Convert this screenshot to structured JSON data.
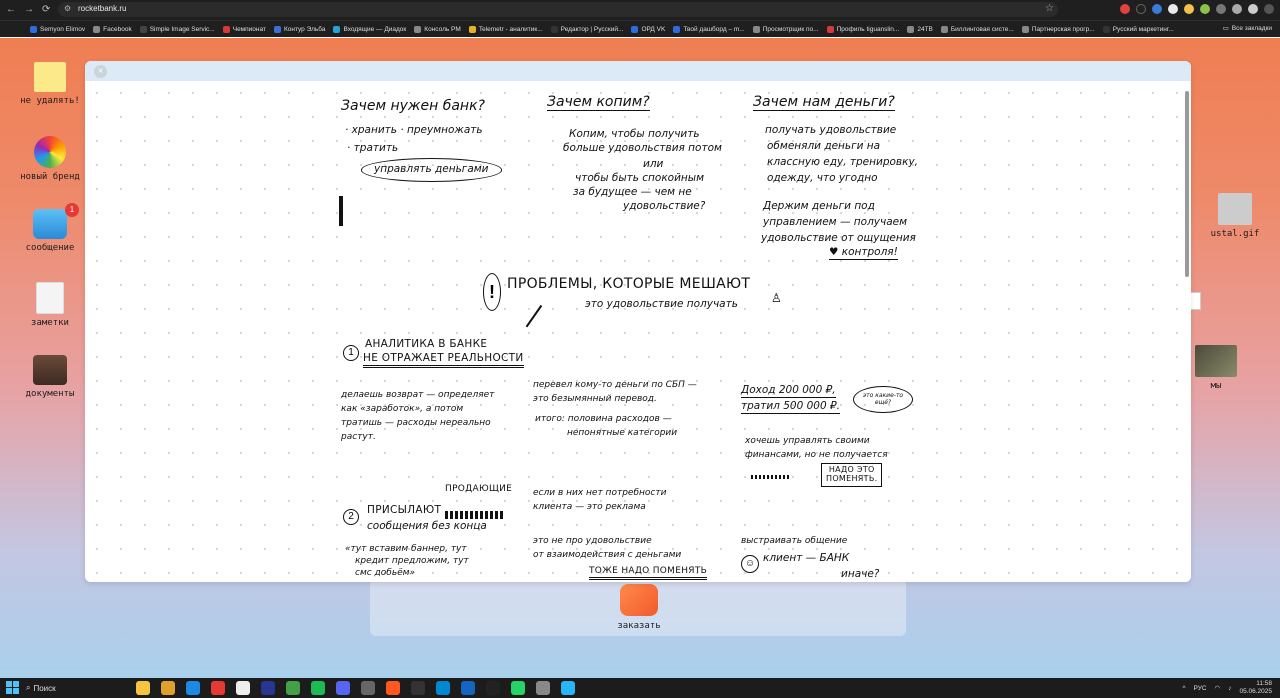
{
  "browser": {
    "url": "rocketbank.ru",
    "bookmarks": [
      {
        "label": "Semyon Elimov",
        "color": "#2d6cdf"
      },
      {
        "label": "Facebook",
        "color": "#888888"
      },
      {
        "label": "Simple Image Servic...",
        "color": "#444444"
      },
      {
        "label": "Чемпионат",
        "color": "#d33a3a"
      },
      {
        "label": "Контур Эльба",
        "color": "#3b6fd8"
      },
      {
        "label": "Входящие — Диадок",
        "color": "#28a0d8"
      },
      {
        "label": "Консоль PM",
        "color": "#888888"
      },
      {
        "label": "Telemetr - аналитик...",
        "color": "#e6b422"
      },
      {
        "label": "Редактор | Русский...",
        "color": "#333333"
      },
      {
        "label": "ОРД VK",
        "color": "#2d6cdf"
      },
      {
        "label": "Твой дашборд – m...",
        "color": "#2d6cdf"
      },
      {
        "label": "Просмотрщик по...",
        "color": "#888888"
      },
      {
        "label": "Профиль tiguanslin...",
        "color": "#d33a3a"
      },
      {
        "label": "24TB",
        "color": "#888888"
      },
      {
        "label": "Биллинговая систе...",
        "color": "#888888"
      },
      {
        "label": "Партнерская прогр...",
        "color": "#888888"
      },
      {
        "label": "Русский маркетинг...",
        "color": "#333333"
      }
    ],
    "all_bookmarks": "Все закладки"
  },
  "desktop": {
    "icons": [
      {
        "label": "не удалять!"
      },
      {
        "label": "новый бренд"
      },
      {
        "label": "сообщение",
        "badge": "1"
      },
      {
        "label": "заметки"
      },
      {
        "label": "документы"
      }
    ],
    "right_icons": [
      {
        "label": "ustal.gif"
      },
      {
        "label": "мы"
      }
    ],
    "order_label": "заказать"
  },
  "board": {
    "q1": {
      "title": "Зачем нужен банк?",
      "l1": "· хранить  · преумножать",
      "l2": "· тратить",
      "circled": "управлять деньгами"
    },
    "q2": {
      "title": "Зачем копим?",
      "l1": "Копим, чтобы получить",
      "l2": "больше удовольствия потом",
      "l3": "или",
      "l4": "чтобы быть спокойным",
      "l5": "за будущее — чем не",
      "l6": "удовольствие?"
    },
    "q3": {
      "title": "Зачем нам деньги?",
      "l1": "получать удовольствие",
      "l2": "обменяли деньги на",
      "l3": "классную еду, тренировку,",
      "l4": "одежду, что угодно",
      "l5": "Держим деньги под",
      "l6": "управлением — получаем",
      "l7": "удовольствие от ощущения",
      "l8": "♥ контроля!"
    },
    "problems": {
      "title": "ПРОБЛЕМЫ, КОТОРЫЕ МЕШАЮТ",
      "subtitle": "это удовольствие получать"
    },
    "p1": {
      "num": "1",
      "title1": "АНАЛИТИКА В БАНКЕ",
      "title2": "НЕ ОТРАЖАЕТ РЕАЛЬНОСТИ",
      "a1": "делаешь возврат — определяет",
      "a2": "как «заработок», а потом",
      "a3": "тратишь — расходы нереально",
      "a4": "растут.",
      "b1": "перевел кому-то деньги по СБП —",
      "b2": "это безымянный перевод.",
      "b3": "итого: половина расходов —",
      "b4": "непонятные категории",
      "c1": "Доход 200 000 ₽,",
      "c2": "тратил 500 000 ₽.",
      "c_bubble": "это какие-то ещё?",
      "c3": "хочешь управлять своими",
      "c4": "финансами, но не получается",
      "c_box1": "НАДО ЭТО",
      "c_box2": "ПОМЕНЯТЬ."
    },
    "p2": {
      "num": "2",
      "above": "ПРОДАЮЩИЕ",
      "title1": "ПРИСЫЛАЮТ",
      "title2": "сообщения без конца",
      "a1": "«тут вставим баннер, тут",
      "a2": "кредит предложим, тут",
      "a3": "смс добьём»",
      "b1": "если в них нет потребности",
      "b2": "клиента — это реклама",
      "b3": "это не про удовольствие",
      "b4": "от взаимодействия с деньгами",
      "b5": "ТОЖЕ НАДО ПОМЕНЯТЬ",
      "c1": "выстраивать общение",
      "c2": "клиент — БАНК",
      "c3": "иначе?"
    }
  },
  "taskbar": {
    "search": "Поиск",
    "lang": "РУС",
    "time": "11:58",
    "date": "05.06.2025"
  }
}
